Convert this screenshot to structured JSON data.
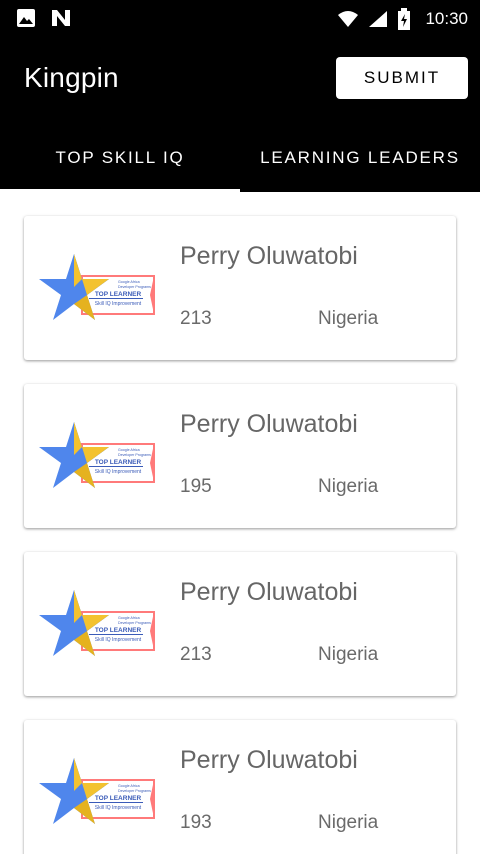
{
  "status_bar": {
    "time": "10:30",
    "icons": [
      "image-icon",
      "n-logo-icon",
      "wifi-icon",
      "signal-icon",
      "battery-icon"
    ]
  },
  "app_bar": {
    "title": "Kingpin",
    "submit_label": "SUBMIT"
  },
  "tabs": [
    {
      "label": "TOP SKILL IQ",
      "active": true
    },
    {
      "label": "LEARNING LEADERS",
      "active": false
    }
  ],
  "badge": {
    "line1": "Google Africa",
    "line2": "Developer Programs",
    "title": "TOP LEARNER",
    "subtitle": "Skill IQ Improvement"
  },
  "list": [
    {
      "name": "Perry Oluwatobi",
      "score": "213",
      "country": "Nigeria"
    },
    {
      "name": "Perry Oluwatobi",
      "score": "195",
      "country": "Nigeria"
    },
    {
      "name": "Perry Oluwatobi",
      "score": "213",
      "country": "Nigeria"
    },
    {
      "name": "Perry Oluwatobi",
      "score": "193",
      "country": "Nigeria"
    }
  ],
  "colors": {
    "bar_background": "#000000",
    "star_blue": "#4f86ec",
    "star_yellow": "#f3c22f",
    "badge_ribbon": "#ff6b6b",
    "badge_text": "#3a5bb8"
  }
}
